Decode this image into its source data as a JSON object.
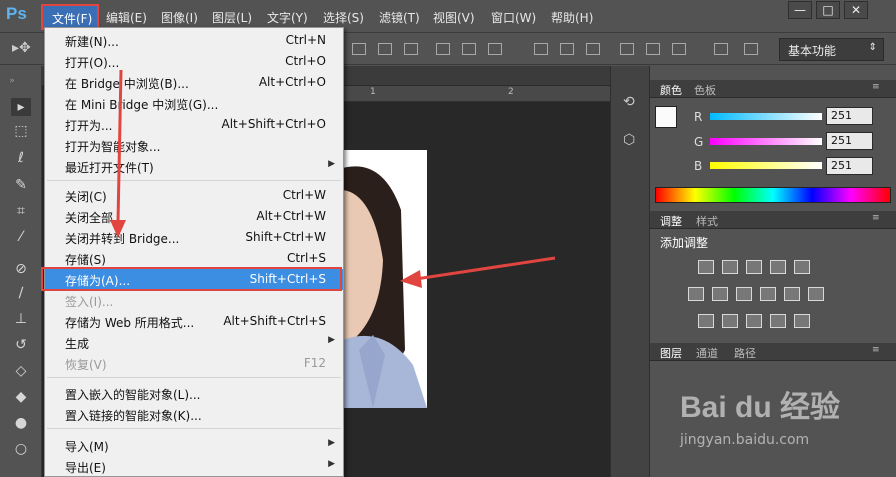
{
  "app": {
    "logo": "Ps"
  },
  "menubar": {
    "items": [
      "文件(F)",
      "编辑(E)",
      "图像(I)",
      "图层(L)",
      "文字(Y)",
      "选择(S)",
      "滤镜(T)",
      "视图(V)",
      "窗口(W)",
      "帮助(H)"
    ],
    "window_buttons": [
      "—",
      "□",
      "✕"
    ]
  },
  "options": {
    "workspace": "基本功能"
  },
  "ruler": {
    "marks": [
      "1",
      "2"
    ]
  },
  "file_menu": {
    "items": [
      {
        "label": "新建(N)...",
        "shortcut": "Ctrl+N"
      },
      {
        "label": "打开(O)...",
        "shortcut": "Ctrl+O"
      },
      {
        "label": "在 Bridge 中浏览(B)...",
        "shortcut": "Alt+Ctrl+O"
      },
      {
        "label": "在 Mini Bridge 中浏览(G)...",
        "shortcut": ""
      },
      {
        "label": "打开为...",
        "shortcut": "Alt+Shift+Ctrl+O"
      },
      {
        "label": "打开为智能对象...",
        "shortcut": ""
      },
      {
        "label": "最近打开文件(T)",
        "shortcut": ""
      },
      {
        "label": "关闭(C)",
        "shortcut": "Ctrl+W"
      },
      {
        "label": "关闭全部",
        "shortcut": "Alt+Ctrl+W"
      },
      {
        "label": "关闭并转到 Bridge...",
        "shortcut": "Shift+Ctrl+W"
      },
      {
        "label": "存储(S)",
        "shortcut": "Ctrl+S"
      },
      {
        "label": "存储为(A)...",
        "shortcut": "Shift+Ctrl+S"
      },
      {
        "label": "签入(I)...",
        "shortcut": ""
      },
      {
        "label": "存储为 Web 所用格式...",
        "shortcut": "Alt+Shift+Ctrl+S"
      },
      {
        "label": "生成",
        "shortcut": ""
      },
      {
        "label": "恢复(V)",
        "shortcut": "F12"
      },
      {
        "label": "置入嵌入的智能对象(L)...",
        "shortcut": ""
      },
      {
        "label": "置入链接的智能对象(K)...",
        "shortcut": ""
      },
      {
        "label": "导入(M)",
        "shortcut": ""
      },
      {
        "label": "导出(E)",
        "shortcut": ""
      }
    ]
  },
  "color_panel": {
    "tabs": [
      "颜色",
      "色板"
    ],
    "channels": [
      {
        "name": "R",
        "value": "251"
      },
      {
        "name": "G",
        "value": "251"
      },
      {
        "name": "B",
        "value": "251"
      }
    ],
    "swatch_fg": "#fbfbfb",
    "swatch_bg": "#f07f2a"
  },
  "adjust_panel": {
    "tabs": [
      "调整",
      "样式"
    ],
    "title": "添加调整"
  },
  "layers_panel": {
    "tabs": [
      "图层",
      "通道",
      "路径"
    ]
  },
  "colors": {
    "highlight": "#3c8ee2",
    "annotation": "#e1453f",
    "menubar": "#535353"
  },
  "watermark": {
    "brand": "Bai du 经验",
    "url": "jingyan.baidu.com"
  }
}
